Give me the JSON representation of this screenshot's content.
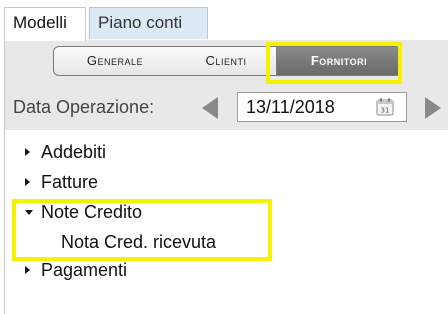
{
  "tabs": [
    {
      "label": "Modelli",
      "active": true
    },
    {
      "label": "Piano conti",
      "active": false
    }
  ],
  "segments": [
    {
      "label": "Generale",
      "selected": false
    },
    {
      "label": "Clienti",
      "selected": false
    },
    {
      "label": "Fornitori",
      "selected": true
    }
  ],
  "date": {
    "label": "Data Operazione:",
    "value": "13/11/2018",
    "calendar_day": "31"
  },
  "tree": [
    {
      "label": "Addebiti",
      "expanded": false
    },
    {
      "label": "Fatture",
      "expanded": false
    },
    {
      "label": "Note Credito",
      "expanded": true,
      "children": [
        {
          "label": "Nota Cred. ricevuta"
        }
      ]
    },
    {
      "label": "Pagamenti",
      "expanded": false
    }
  ],
  "colors": {
    "highlight": "#f5f200",
    "selected_segment": "#777777",
    "toolbar_bg": "#e8e8e8",
    "inactive_tab_bg": "#dde8f5"
  }
}
